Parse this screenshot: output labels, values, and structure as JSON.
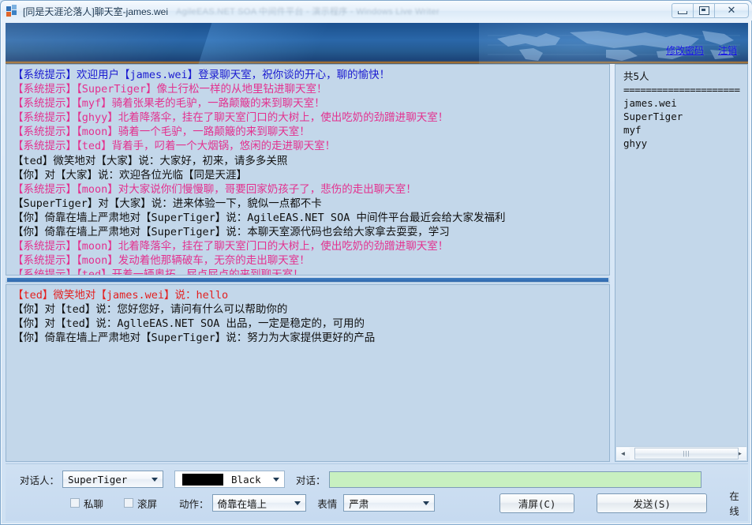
{
  "window": {
    "title": "[同是天涯沦落人]聊天室-james.wei",
    "ghost_title": "AgileEAS.NET SOA 中间件平台 - 演示程序 - Windows Live Writer",
    "minimize_label": "最小化",
    "maximize_label": "还原",
    "close_label": "✕"
  },
  "banner": {
    "change_password_link": "修改密码",
    "logout_link": "注销"
  },
  "chat_top": {
    "lines": [
      {
        "color": "blue",
        "text": "【系统提示】欢迎用户【james.wei】登录聊天室，祝你谈的开心，聊的愉快！"
      },
      {
        "color": "magenta",
        "text": "【系统提示】【SuperTiger】像土行松一样的从地里钻进聊天室！"
      },
      {
        "color": "magenta",
        "text": "【系统提示】【myf】骑着张果老的毛驴，一路颠簸的来到聊天室！"
      },
      {
        "color": "magenta",
        "text": "【系统提示】【ghyy】北着降落伞，挂在了聊天室门口的大树上，使出吃奶的劲蹭进聊天室！"
      },
      {
        "color": "magenta",
        "text": "【系统提示】【moon】骑着一个毛驴，一路颠簸的来到聊天室！"
      },
      {
        "color": "magenta",
        "text": "【系统提示】【ted】背着手，叼着一个大烟锅，悠闲的走进聊天室！"
      },
      {
        "color": "black",
        "text": "【ted】微笑地对【大家】说：大家好，初来，请多多关照"
      },
      {
        "color": "black",
        "text": "【你】对【大家】说：欢迎各位光临【同是天涯】"
      },
      {
        "color": "magenta",
        "text": "【系统提示】【moon】对大家说你们慢慢聊，哥要回家奶孩子了，悲伤的走出聊天室！"
      },
      {
        "color": "black",
        "text": "【SuperTiger】对【大家】说：进来体验一下，貌似一点都不卡"
      },
      {
        "color": "black",
        "text": "【你】倚靠在墙上严肃地对【SuperTiger】说：AgileEAS.NET SOA 中间件平台最近会给大家发福利"
      },
      {
        "color": "black",
        "text": "【你】倚靠在墙上严肃地对【SuperTiger】说：本聊天室源代码也会给大家拿去耍耍，学习"
      },
      {
        "color": "magenta",
        "text": "【系统提示】【moon】北着降落伞，挂在了聊天室门口的大树上，使出吃奶的劲蹭进聊天室！"
      },
      {
        "color": "magenta",
        "text": "【系统提示】【moon】发动着他那辆破车，无奈的走出聊天室！"
      },
      {
        "color": "magenta",
        "text": "【系统提示】【ted】开着一辆奥拓，屁点屁点的来到聊天室！"
      }
    ]
  },
  "chat_bottom": {
    "lines": [
      {
        "color": "red",
        "text": "【ted】微笑地对【james.wei】说：hello"
      },
      {
        "color": "black",
        "text": "【你】对【ted】说：您好您好，请问有什么可以帮助你的"
      },
      {
        "color": "black",
        "text": "【你】对【ted】说：AglleEAS.NET SOA 出品，一定是稳定的，可用的"
      },
      {
        "color": "black",
        "text": "【你】倚靠在墙上严肃地对【SuperTiger】说：努力为大家提供更好的产品"
      }
    ]
  },
  "userlist": {
    "count_label": "共5人",
    "separator": "=====================",
    "users": [
      "james.wei",
      "SuperTiger",
      "myf",
      "ghyy"
    ]
  },
  "toolbar": {
    "target_label": "对话人：",
    "target_value": "SuperTiger",
    "color_value": "Black",
    "color_hex": "#000000",
    "message_label": "对话：",
    "message_value": "",
    "message_placeholder": "",
    "private_chat_label": "私聊",
    "scroll_label": "滚屏",
    "action_label": "动作：",
    "action_value": "倚靠在墙上",
    "emotion_label": "表情",
    "emotion_value": "严肃",
    "clear_button": "清屏(C)",
    "send_button": "发送(S)",
    "status": "在线"
  },
  "scrollbar": {
    "left_arrow": "◄",
    "right_arrow": "►",
    "grip": "|||"
  }
}
